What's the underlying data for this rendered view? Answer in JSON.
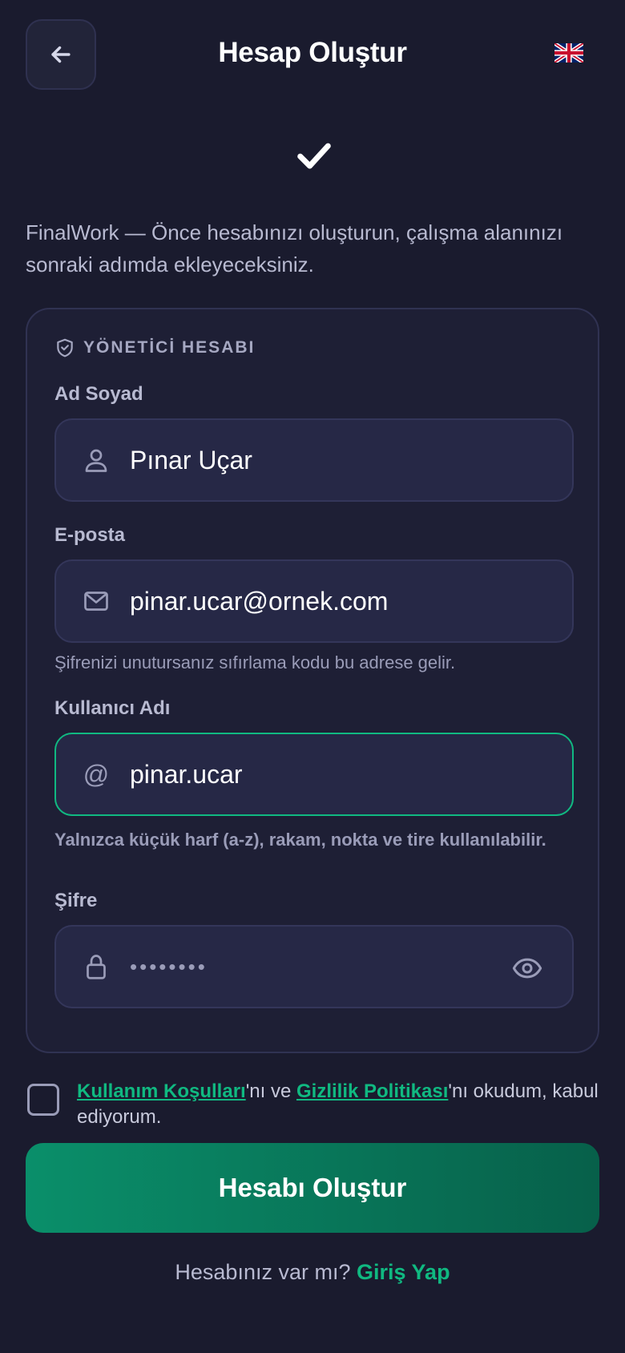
{
  "header": {
    "title": "Hesap Oluştur",
    "language_flag": "uk-flag-icon"
  },
  "intro_text": "FinalWork — Önce hesabınızı oluşturun, çalışma alanınızı sonraki adımda ekleyeceksiniz.",
  "form": {
    "section_title": "YÖNETİCİ HESABI",
    "fullname": {
      "label": "Ad Soyad",
      "value": "Pınar Uçar"
    },
    "email": {
      "label": "E-posta",
      "value": "pinar.ucar@ornek.com",
      "hint": "Şifrenizi unutursanız sıfırlama kodu bu adrese gelir."
    },
    "username": {
      "label": "Kullanıcı Adı",
      "value": "pinar.ucar",
      "hint": "Yalnızca küçük harf (a-z), rakam, nokta ve tire kullanılabilir."
    },
    "password": {
      "label": "Şifre",
      "value": "••••••••"
    }
  },
  "terms": {
    "terms_link": "Kullanım Koşulları",
    "connector": "'nı ve ",
    "privacy_link": "Gizlilik Politikası",
    "suffix": "'nı okudum, kabul ediyorum."
  },
  "submit_label": "Hesabı Oluştur",
  "login": {
    "prompt": "Hesabınız var mı? ",
    "link": "Giriş Yap"
  },
  "colors": {
    "background": "#1a1b2e",
    "accent": "#10b981",
    "button_start": "#0a8f6a",
    "button_end": "#07604a"
  }
}
